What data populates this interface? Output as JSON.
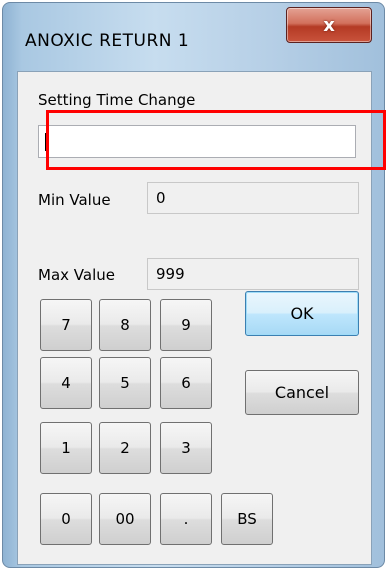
{
  "window": {
    "title": "ANOXIC RETURN 1",
    "close_glyph": "x"
  },
  "form": {
    "setting_label": "Setting Time Change",
    "input_value": "",
    "min_label": "Min Value",
    "min_value": "0",
    "max_label": "Max Value",
    "max_value": "999"
  },
  "keypad": {
    "row1": [
      "7",
      "8",
      "9"
    ],
    "row2": [
      "4",
      "5",
      "6"
    ],
    "row3": [
      "1",
      "2",
      "3"
    ],
    "row4": [
      "0",
      "00",
      ".",
      "BS"
    ]
  },
  "buttons": {
    "ok": "OK",
    "cancel": "Cancel"
  },
  "colors": {
    "highlight": "#ff0000",
    "close_button": "#c9533c",
    "default_button_border": "#3c7fb1"
  }
}
